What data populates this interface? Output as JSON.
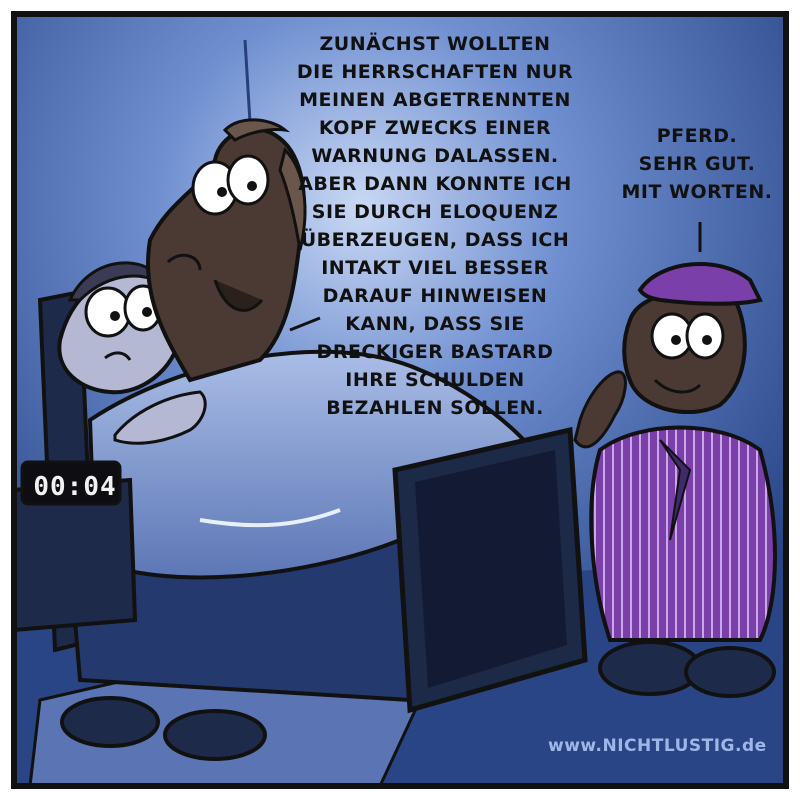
{
  "comic": {
    "horse_speech": [
      "ZUNÄCHST WOLLTEN",
      "DIE HERRSCHAFTEN NUR",
      "MEINEN ABGETRENNTEN",
      "KOPF ZWECKS EINER",
      "WARNUNG DALASSEN.",
      "ABER DANN KONNTE ICH",
      "SIE DURCH ELOQUENZ",
      "ÜBERZEUGEN, DASS ICH",
      "INTAKT VIEL BESSER",
      "DARAUF HINWEISEN",
      "KANN, DASS SIE",
      "DRECKIGER BASTARD",
      "IHRE SCHULDEN",
      "BEZAHLEN SOLLEN."
    ],
    "man_speech": [
      "PFERD.",
      "SEHR GUT.",
      "MIT WORTEN."
    ],
    "clock": "00:04",
    "credit": "www.NICHTLUSTIG.de"
  },
  "colors": {
    "frame": "#111111",
    "wall": "#2c4f9a",
    "wall_glow": "#9fb8ea",
    "blanket": "#7f98cf",
    "suit": "#7a3fa8",
    "horse": "#4a3a33"
  }
}
